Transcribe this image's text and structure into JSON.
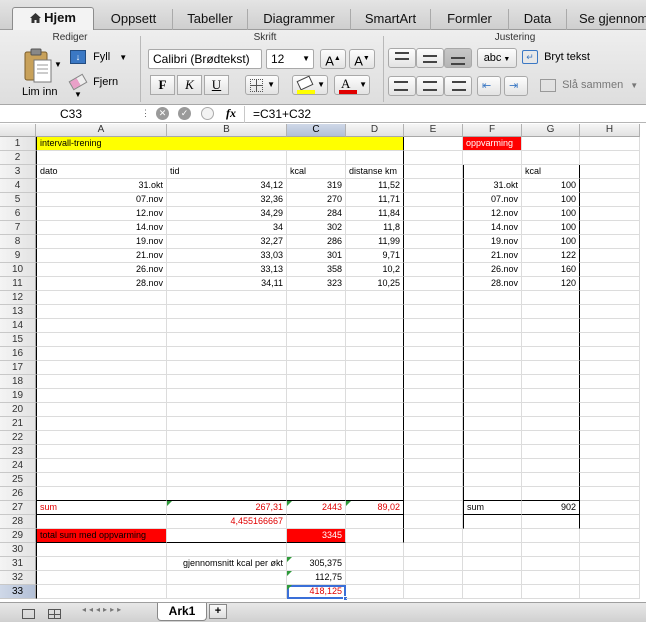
{
  "ribbon_tabs": [
    "Hjem",
    "Oppsett",
    "Tabeller",
    "Diagrammer",
    "SmartArt",
    "Formler",
    "Data",
    "Se gjennom"
  ],
  "ribbon": {
    "group_edit": "Rediger",
    "group_font": "Skrift",
    "group_align": "Justering",
    "paste_label": "Lim inn",
    "fill_label": "Fyll",
    "clear_label": "Fjern",
    "font_name": "Calibri (Brødtekst)",
    "font_size": "12",
    "grow_label": "A",
    "shrink_label": "A",
    "bold": "F",
    "italic": "K",
    "underline": "U",
    "abc_label": "abc",
    "wrap_label": "Bryt tekst",
    "merge_label": "Slå sammen"
  },
  "formula_bar": {
    "name_box": "C33",
    "fx": "fx",
    "formula": "=C31+C32"
  },
  "columns": [
    "A",
    "B",
    "C",
    "D",
    "E",
    "F",
    "G",
    "H"
  ],
  "rows": [
    "1",
    "2",
    "3",
    "4",
    "5",
    "6",
    "7",
    "8",
    "9",
    "10",
    "11",
    "12",
    "13",
    "14",
    "15",
    "16",
    "17",
    "18",
    "19",
    "20",
    "21",
    "22",
    "23",
    "24",
    "25",
    "26",
    "27",
    "28",
    "29",
    "30",
    "31",
    "32",
    "33"
  ],
  "cells": {
    "A1": "intervall-trening",
    "F1": "oppvarming",
    "A3": "dato",
    "B3": "tid",
    "C3": "kcal",
    "D3": "distanse km",
    "G3": "kcal",
    "A4": "31.okt",
    "B4": "34,12",
    "C4": "319",
    "D4": "11,52",
    "F4": "31.okt",
    "G4": "100",
    "A5": "07.nov",
    "B5": "32,36",
    "C5": "270",
    "D5": "11,71",
    "F5": "07.nov",
    "G5": "100",
    "A6": "12.nov",
    "B6": "34,29",
    "C6": "284",
    "D6": "11,84",
    "F6": "12.nov",
    "G6": "100",
    "A7": "14.nov",
    "B7": "34",
    "C7": "302",
    "D7": "11,8",
    "F7": "14.nov",
    "G7": "100",
    "A8": "19.nov",
    "B8": "32,27",
    "C8": "286",
    "D8": "11,99",
    "F8": "19.nov",
    "G8": "100",
    "A9": "21.nov",
    "B9": "33,03",
    "C9": "301",
    "D9": "9,71",
    "F9": "21.nov",
    "G9": "122",
    "A10": "26.nov",
    "B10": "33,13",
    "C10": "358",
    "D10": "10,2",
    "F10": "26.nov",
    "G10": "160",
    "A11": "28.nov",
    "B11": "34,11",
    "C11": "323",
    "D11": "10,25",
    "F11": "28.nov",
    "G11": "120",
    "A27": "sum",
    "B27": "267,31",
    "C27": "2443",
    "D27": "89,02",
    "F27": "sum",
    "G27": "902",
    "B28": "4,455166667",
    "A29": "total sum med oppvarming",
    "C29": "3345",
    "B31": "gjennomsnitt kcal per økt",
    "C31": "305,375",
    "C32": "112,75",
    "C33": "418,125"
  },
  "sheet_tab": "Ark1",
  "add_sheet": "+",
  "colors": {
    "yellow": "#ffff00",
    "red": "#ff0000",
    "red_text": "#e00000",
    "selection": "#3a6fd8"
  }
}
